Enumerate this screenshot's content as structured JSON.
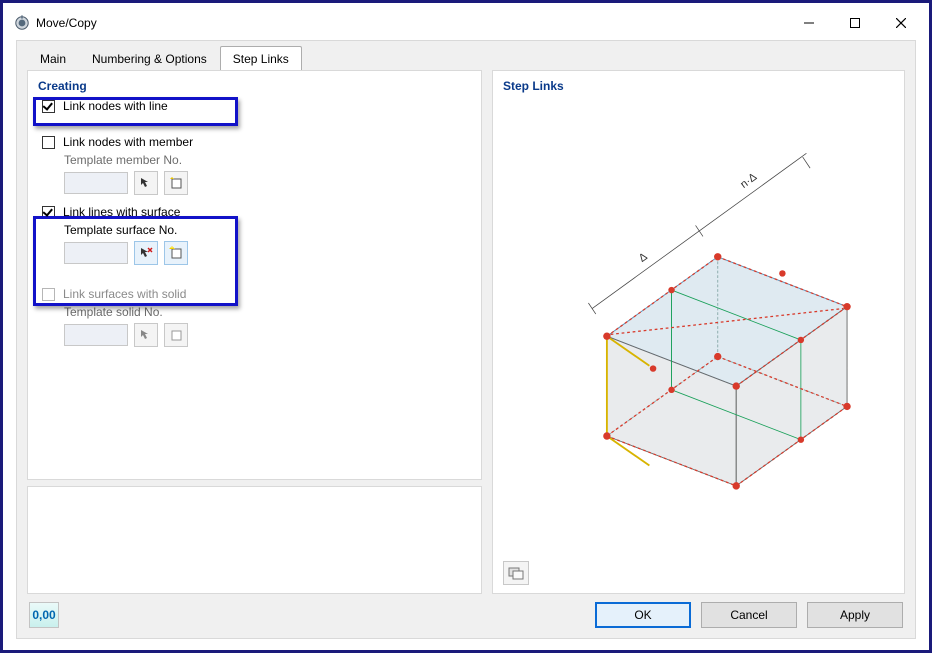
{
  "window": {
    "title": "Move/Copy"
  },
  "tabs": {
    "main": "Main",
    "numbering": "Numbering & Options",
    "step_links": "Step Links"
  },
  "left": {
    "section": "Creating",
    "link_nodes_line": {
      "label": "Link nodes with line",
      "checked": true
    },
    "link_nodes_member": {
      "label": "Link nodes with member",
      "checked": false,
      "template_label": "Template member No."
    },
    "link_lines_surface": {
      "label": "Link lines with surface",
      "checked": true,
      "template_label": "Template surface No."
    },
    "link_surfaces_solid": {
      "label": "Link surfaces with solid",
      "checked": false,
      "disabled": true,
      "template_label": "Template solid No."
    }
  },
  "right": {
    "section": "Step Links"
  },
  "footer": {
    "units_btn": "0,00",
    "ok": "OK",
    "cancel": "Cancel",
    "apply": "Apply"
  },
  "icons": {
    "pick": "pick-icon",
    "new": "new-icon",
    "view_tool": "view-tool-icon"
  }
}
